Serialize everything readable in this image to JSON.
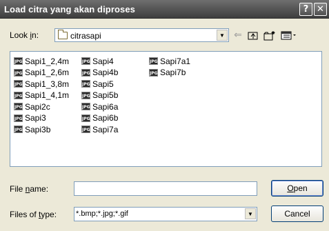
{
  "window": {
    "title": "Load citra yang akan diproses",
    "help_glyph": "?",
    "close_glyph": "✕"
  },
  "lookin": {
    "label_pre": "Look ",
    "label_u": "i",
    "label_post": "n:",
    "value": "citrasapi"
  },
  "files": [
    "Sapi1_2,4m",
    "Sapi1_2,6m",
    "Sapi1_3,8m",
    "Sapi1_4,1m",
    "Sapi2c",
    "Sapi3",
    "Sapi3b",
    "Sapi4",
    "Sapi4b",
    "Sapi5",
    "Sapi5b",
    "Sapi6a",
    "Sapi6b",
    "Sapi7a",
    "Sapi7a1",
    "Sapi7b"
  ],
  "file_icon_text": "JPG",
  "filename": {
    "label_pre": "File ",
    "label_u": "n",
    "label_post": "ame:",
    "value": ""
  },
  "filetype": {
    "label_pre": "Files of ",
    "label_u": "t",
    "label_post": "ype:",
    "value": "*.bmp;*.jpg;*.gif"
  },
  "buttons": {
    "open_u": "O",
    "open_rest": "pen",
    "cancel": "Cancel"
  },
  "colors": {
    "title_bar": "#585858",
    "dialog_bg": "#ece9d8",
    "input_border": "#7f9db9"
  }
}
